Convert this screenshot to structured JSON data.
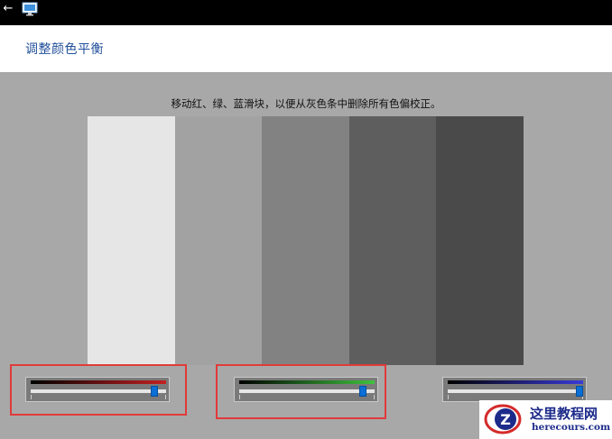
{
  "window": {
    "back_icon": "back-arrow-icon",
    "app_icon": "display-monitor-icon"
  },
  "header": {
    "title": "调整颜色平衡"
  },
  "main": {
    "instructions": "移动红、绿、蓝滑块，以便从灰色条中删除所有色偏校正。",
    "gray_bars": [
      {
        "color": "#e6e6e6"
      },
      {
        "color": "#a2a2a2"
      },
      {
        "color": "#828282"
      },
      {
        "color": "#5e5e5e"
      },
      {
        "color": "#4a4a4a"
      }
    ],
    "background_color": "#a8a8a8"
  },
  "sliders": [
    {
      "name": "red",
      "gradient_end": "#c42020",
      "value_fraction": 0.91,
      "highlighted": true
    },
    {
      "name": "green",
      "gradient_end": "#3fc23f",
      "value_fraction": 0.91,
      "highlighted": true
    },
    {
      "name": "blue",
      "gradient_end": "#3a3ad8",
      "value_fraction": 0.97,
      "highlighted": false
    }
  ],
  "annotation_color": "#e13a3a",
  "watermark": {
    "text_cn": "这里教程网",
    "text_en": "herecours.com"
  }
}
